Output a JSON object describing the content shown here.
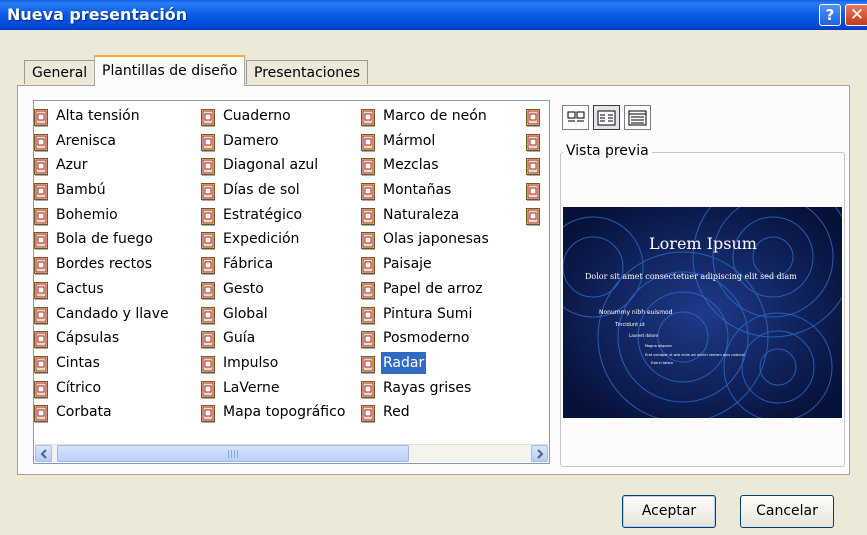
{
  "window": {
    "title": "Nueva presentación",
    "help_glyph": "?",
    "close_glyph": "✕"
  },
  "tabs": [
    {
      "label": "General"
    },
    {
      "label": "Plantillas de diseño",
      "active": true
    },
    {
      "label": "Presentaciones"
    }
  ],
  "templates": {
    "columns": [
      [
        "Alta tensión",
        "Arenisca",
        "Azur",
        "Bambú",
        "Bohemio",
        "Bola de fuego",
        "Bordes rectos",
        "Cactus",
        "Candado y llave",
        "Cápsulas",
        "Cintas",
        "Cítrico",
        "Corbata"
      ],
      [
        "Cuaderno",
        "Damero",
        "Diagonal azul",
        "Días de sol",
        "Estratégico",
        "Expedición",
        "Fábrica",
        "Gesto",
        "Global",
        "Guía",
        "Impulso",
        "LaVerne",
        "Mapa topográfico"
      ],
      [
        "Marco de neón",
        "Mármol",
        "Mezclas",
        "Montañas",
        "Naturaleza",
        "Olas japonesas",
        "Paisaje",
        "Papel de arroz",
        "Pintura Sumi",
        "Posmoderno",
        "Radar",
        "Rayas grises",
        "Red"
      ],
      [
        "",
        "",
        "",
        "",
        ""
      ]
    ],
    "selected": "Radar"
  },
  "view_buttons": [
    {
      "name": "large-icons",
      "icon": "large-icons-view-icon",
      "active": false
    },
    {
      "name": "list",
      "icon": "list-view-icon",
      "active": true
    },
    {
      "name": "details",
      "icon": "details-view-icon",
      "active": false
    }
  ],
  "preview": {
    "legend": "Vista previa",
    "slide_title": "Lorem Ipsum",
    "bullet1": "Dolor sit amet consectetuer adipiscing elit sed diam",
    "bullet2": "Nonummy nibh euismod",
    "bullet3": "Tincidunt ut",
    "bullet4": "Laoreet dolore",
    "bullet5": "Magna aliquam",
    "bullet6": "Erat volutpat ut wisi enim ad minim veniam quis nostrud",
    "bullet7": "Exerci tation",
    "colors": {
      "background": "#0b1a4a",
      "rings": "#2a6fd0",
      "text": "#ffffff"
    }
  },
  "buttons": {
    "ok": "Aceptar",
    "cancel": "Cancelar"
  },
  "colors": {
    "titlebar": "#0a5ee8",
    "selection": "#316ac5",
    "dialog_bg": "#ece9d8"
  }
}
